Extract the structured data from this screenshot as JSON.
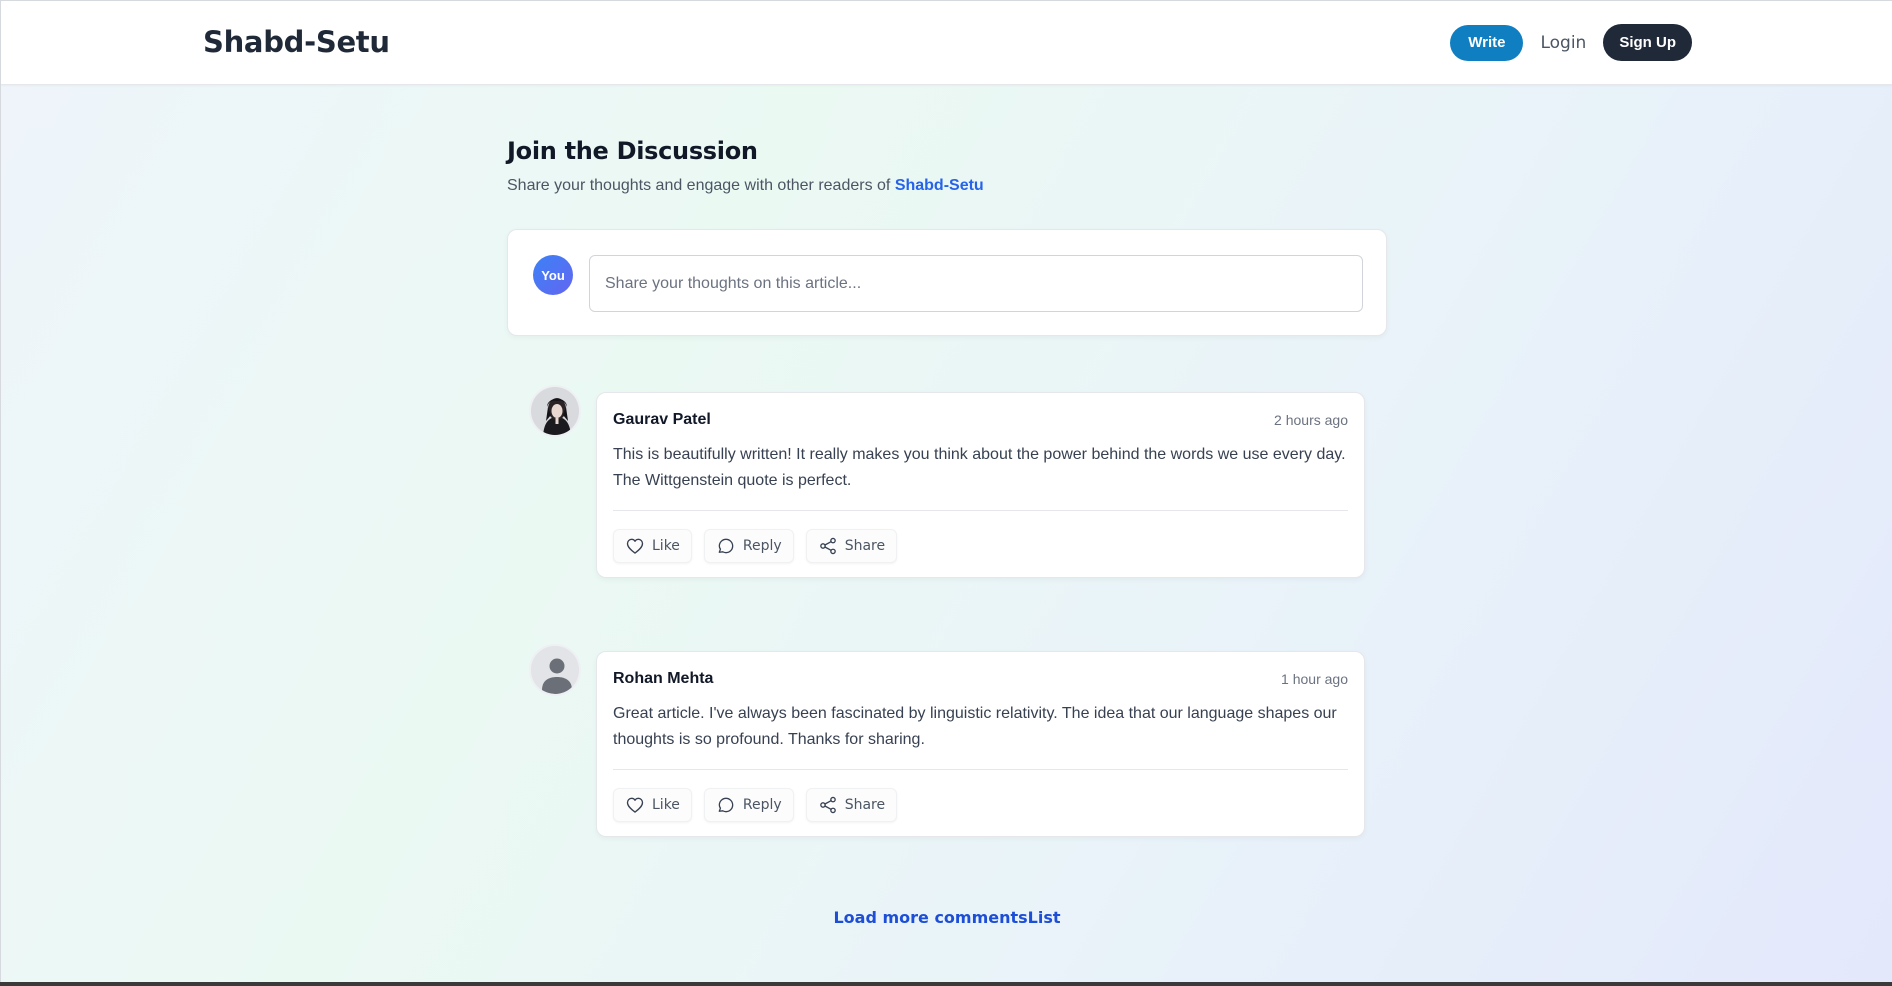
{
  "header": {
    "logo": "Shabd-Setu",
    "nav": {
      "write": "Write",
      "login": "Login",
      "signup": "Sign Up"
    }
  },
  "discussion": {
    "title": "Join the Discussion",
    "subtitle_prefix": "Share your thoughts and engage with other readers of ",
    "subtitle_brand": "Shabd-Setu"
  },
  "compose": {
    "avatar_label": "You",
    "placeholder": "Share your thoughts on this article..."
  },
  "comments": [
    {
      "author": "Gaurav Patel",
      "time": "2 hours ago",
      "body": "This is beautifully written! It really makes you think about the power behind the words we use every day. The Wittgenstein quote is perfect.",
      "avatar": "portrait-photo",
      "actions": {
        "like": "Like",
        "reply": "Reply",
        "share": "Share"
      }
    },
    {
      "author": "Rohan Mehta",
      "time": "1 hour ago",
      "body": "Great article. I've always been fascinated by linguistic relativity. The idea that our language shapes our thoughts is so profound. Thanks for sharing.",
      "avatar": "default-user-icon",
      "actions": {
        "like": "Like",
        "reply": "Reply",
        "share": "Share"
      }
    }
  ],
  "load_more": "Load more commentsList",
  "colors": {
    "primary_button": "#0f7fc2",
    "dark_button": "#1f2937",
    "brand_link": "#2563eb",
    "avatar_gradient_start": "#3b82f6",
    "avatar_gradient_end": "#6366f1"
  }
}
